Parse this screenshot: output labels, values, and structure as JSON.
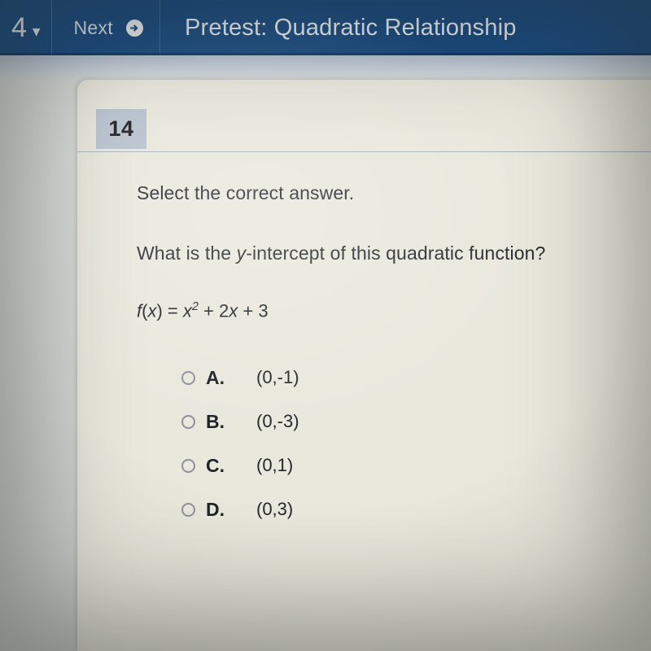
{
  "toolbar": {
    "question_number": "4",
    "chevron_icon": "chevron-down-icon",
    "next_label": "Next",
    "next_arrow_icon": "arrow-right-circle-icon",
    "title": "Pretest: Quadratic Relationship",
    "background_color": "#174a81",
    "text_color": "#edf2f7"
  },
  "card": {
    "question_badge": "14",
    "badge_color": "#b9c3cf",
    "background_color": "#e9e8dd",
    "prompt": "Select the correct answer.",
    "question": {
      "before_var": "What is the ",
      "var": "y",
      "after_var": "-intercept of this quadratic function?"
    },
    "formula": {
      "fn": "f",
      "open": "(",
      "arg": "x",
      "close": ")",
      "equals": " = ",
      "term1_base": "x",
      "term1_exp": "2",
      "term2": " + 2",
      "term2_var": "x",
      "term3": " + 3"
    },
    "options": [
      {
        "letter": "A.",
        "value": "(0,-1)",
        "selected": false
      },
      {
        "letter": "B.",
        "value": "(0,-3)",
        "selected": false
      },
      {
        "letter": "C.",
        "value": "(0,1)",
        "selected": false
      },
      {
        "letter": "D.",
        "value": "(0,3)",
        "selected": false
      }
    ]
  }
}
